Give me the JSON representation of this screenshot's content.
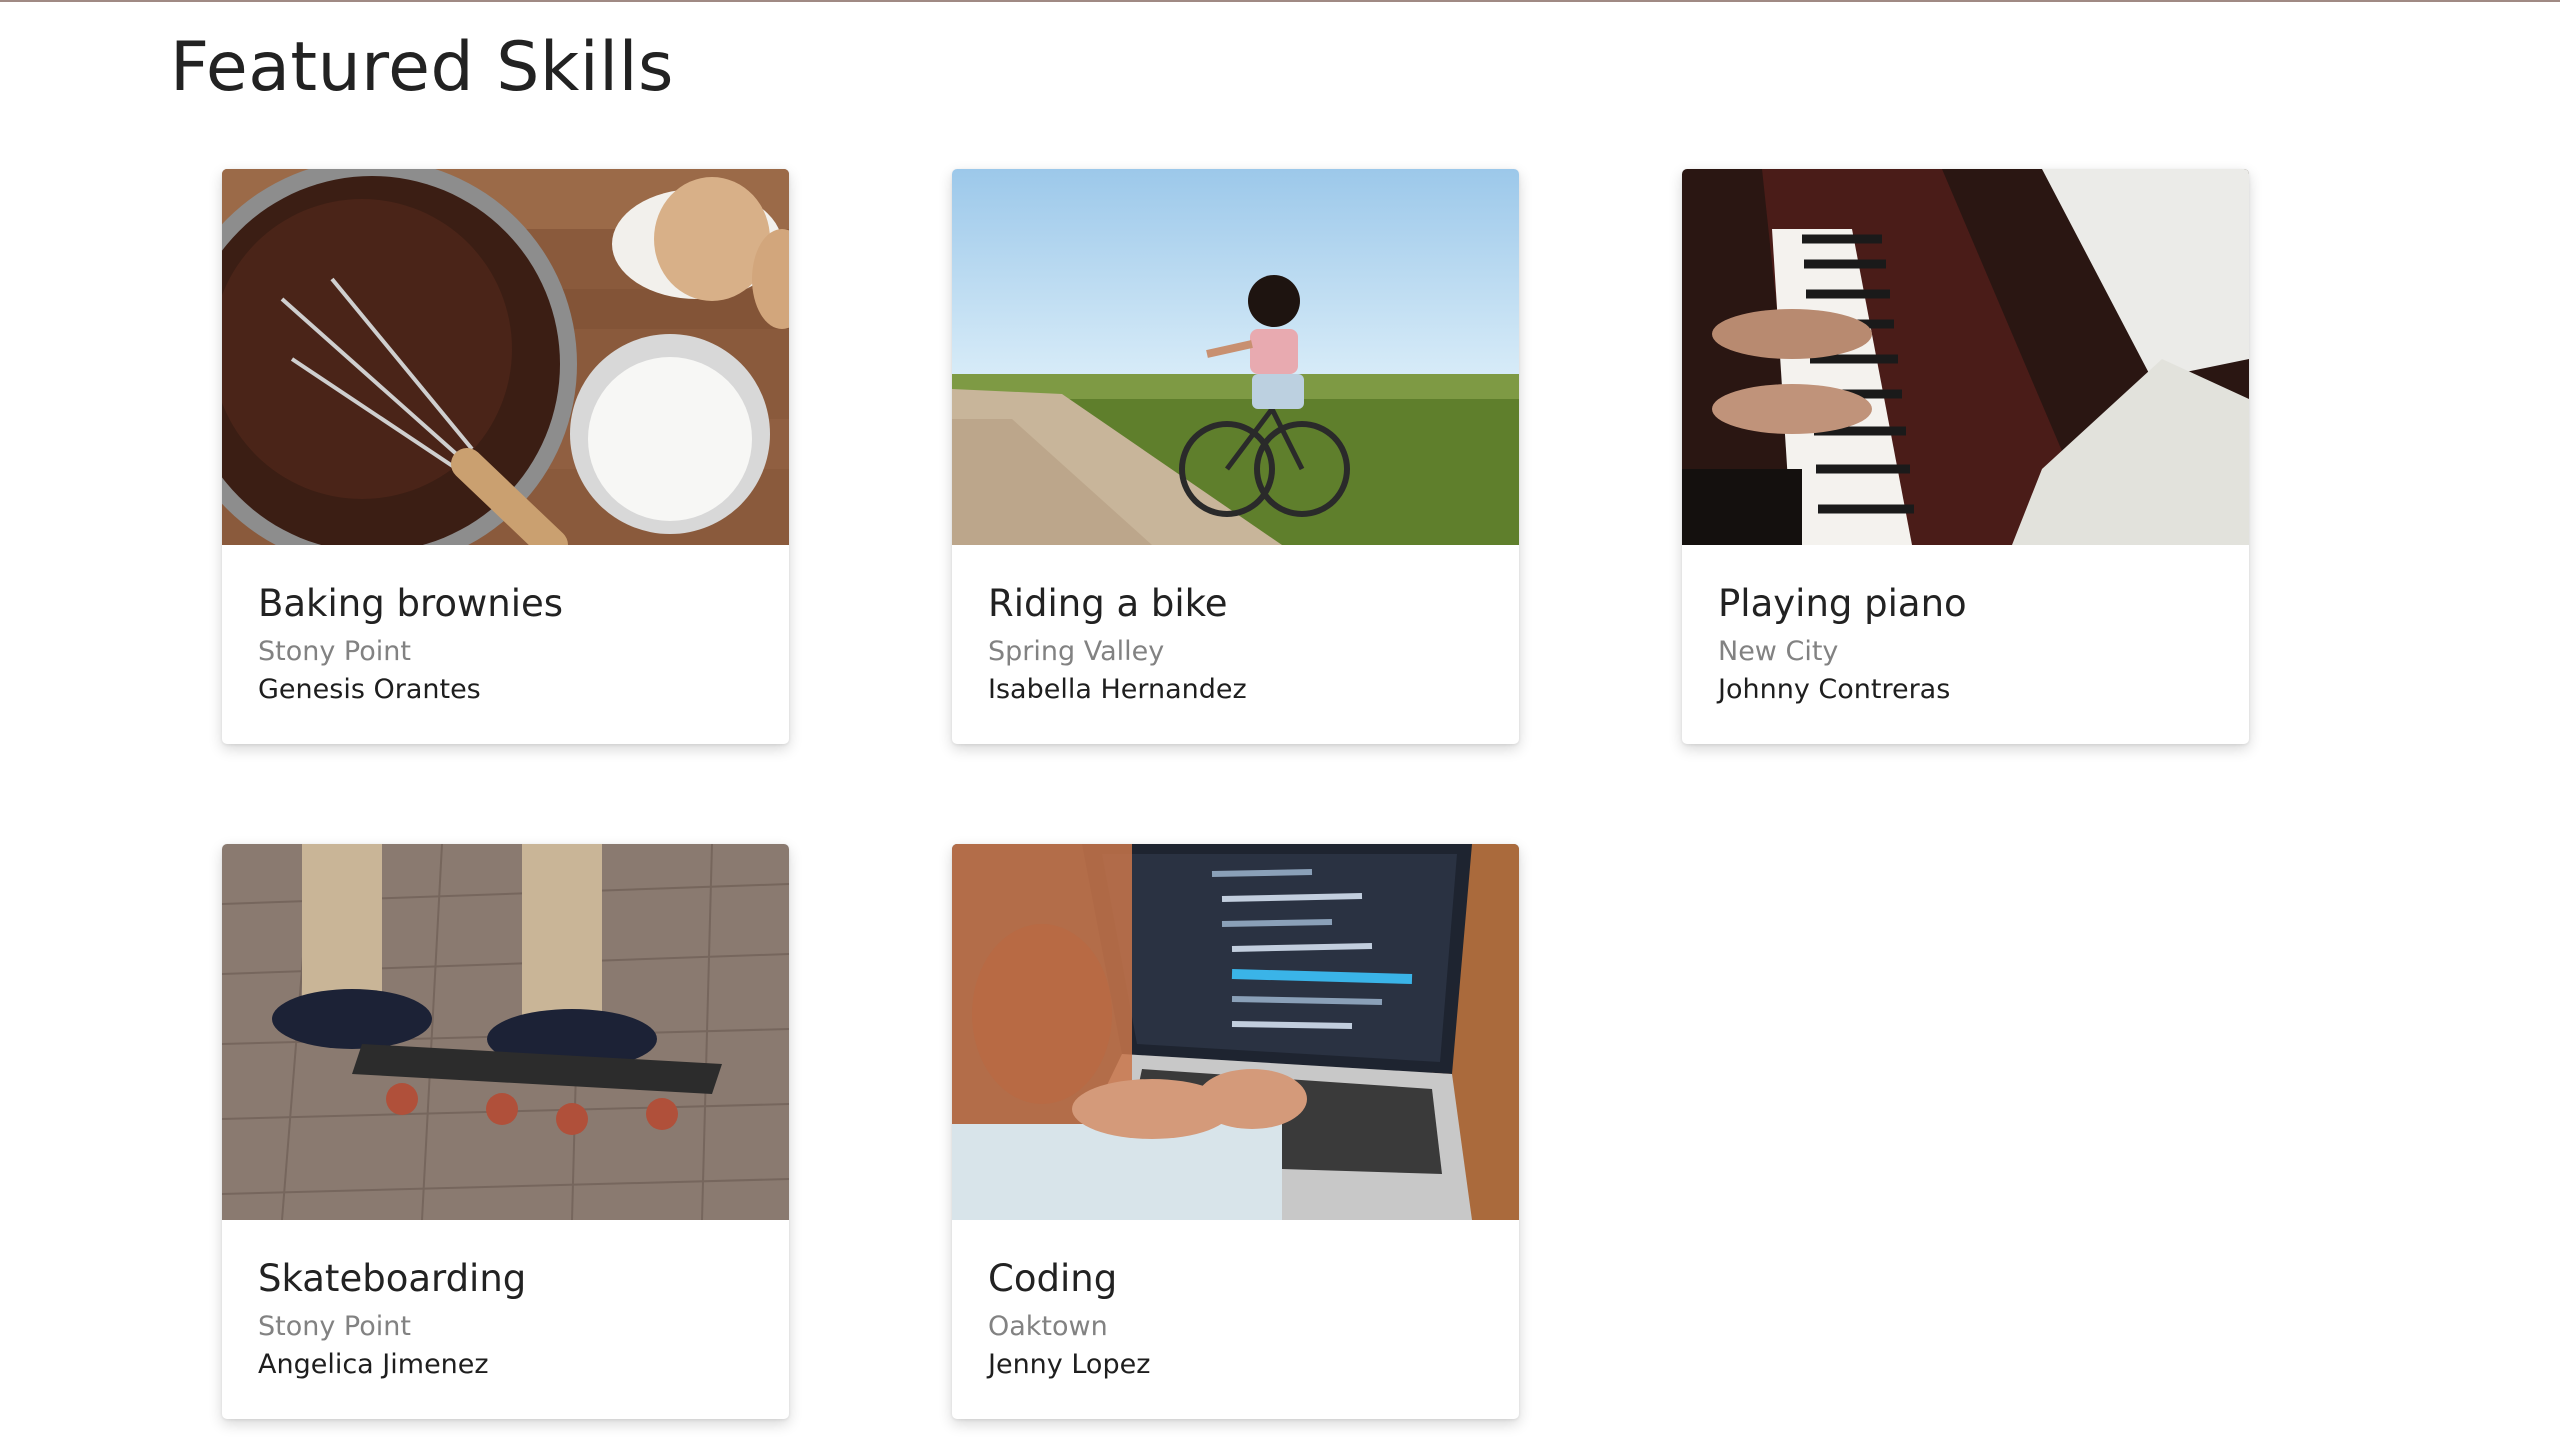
{
  "page": {
    "title": "Featured Skills",
    "accent_border_color": "#a08a84"
  },
  "skills": [
    {
      "title": "Baking brownies",
      "location": "Stony Point",
      "person": "Genesis Orantes",
      "image": "baking-photo"
    },
    {
      "title": "Riding a bike",
      "location": "Spring Valley",
      "person": "Isabella Hernandez",
      "image": "cycling-photo"
    },
    {
      "title": "Playing piano",
      "location": "New City",
      "person": "Johnny Contreras",
      "image": "piano-photo"
    },
    {
      "title": "Skateboarding",
      "location": "Stony Point",
      "person": "Angelica Jimenez",
      "image": "skateboard-photo"
    },
    {
      "title": "Coding",
      "location": "Oaktown",
      "person": "Jenny Lopez",
      "image": "coding-photo"
    }
  ]
}
